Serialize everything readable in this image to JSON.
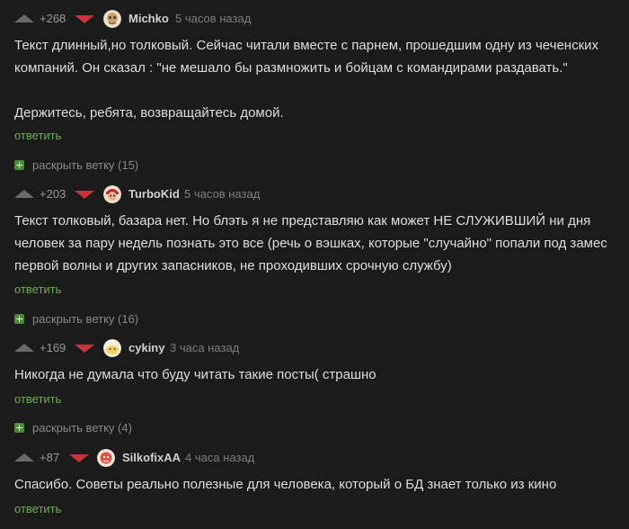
{
  "comments": [
    {
      "rating": "+268",
      "author": "Michko",
      "time": "5 часов назад",
      "lines": [
        "Текст длинный,но толковый. Сейчас читали вместе с парнем, прошедшим одну из чеченских компаний. Он сказал : \"не мешало бы размножить и бойцам с командирами раздавать.\"",
        "Держитесь, ребята, возвращайтесь домой."
      ],
      "reply": "ответить",
      "expand": "раскрыть ветку (15)"
    },
    {
      "rating": "+203",
      "author": "TurboKid",
      "time": "5 часов назад",
      "lines": [
        "Текст толковый, базара нет. Но блэть я не представляю как может НЕ СЛУЖИВШИЙ ни дня человек за пару недель познать это все (речь о вэшках, которые \"случайно\" попали под замес первой волны и других запасников, не проходивших срочную службу)"
      ],
      "reply": "ответить",
      "expand": "раскрыть ветку (16)"
    },
    {
      "rating": "+169",
      "author": "cykiny",
      "time": "3 часа назад",
      "lines": [
        "Никогда не думала что буду читать такие посты( страшно"
      ],
      "reply": "ответить",
      "expand": "раскрыть ветку (4)"
    },
    {
      "rating": "+87",
      "author": "SilkofixAA",
      "time": "4 часа назад",
      "lines": [
        "Спасибо. Советы реально полезные для человека, который о БД знает только из кино"
      ],
      "reply": "ответить"
    }
  ],
  "colors": {
    "background": "#1b1b1c",
    "upvote": "#6a6a6c",
    "downvote": "#c9343a",
    "reply_link": "#6fae52",
    "expand_icon": "#4d8a3a"
  },
  "icons": {
    "upvote": "upvote-arrow-icon",
    "downvote": "downvote-arrow-icon",
    "expand": "plus-square-icon"
  }
}
